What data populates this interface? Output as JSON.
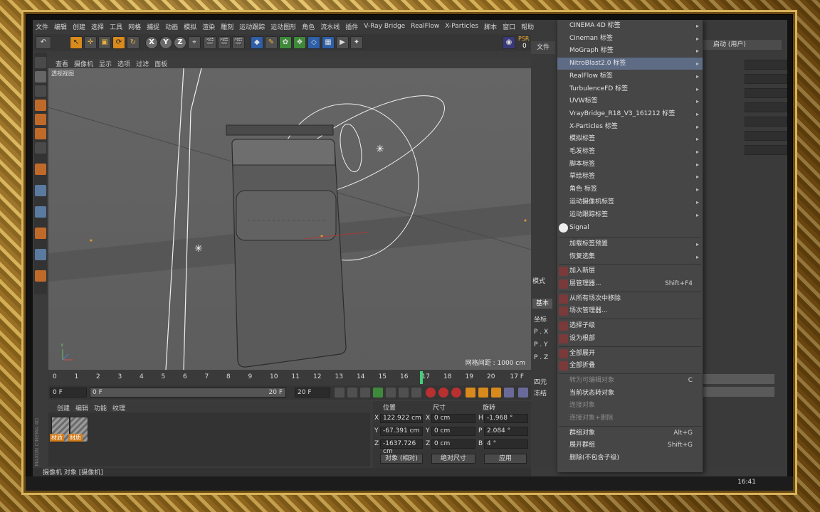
{
  "menubar": [
    "文件",
    "编辑",
    "创建",
    "选择",
    "工具",
    "网格",
    "捕捉",
    "动画",
    "模拟",
    "渲染",
    "雕刻",
    "运动跟踪",
    "运动图形",
    "角色",
    "流水线",
    "插件",
    "V-Ray Bridge",
    "RealFlow",
    "X-Particles",
    "脚本",
    "窗口",
    "帮助"
  ],
  "toolbar": {
    "undo_icon": "undo-icon",
    "x": "X",
    "y": "Y",
    "z": "Z",
    "psr_label": "PSR",
    "psr_value": "0"
  },
  "viewport": {
    "menu": [
      "查看",
      "摄像机",
      "显示",
      "选项",
      "过滤",
      "面板"
    ],
    "label": "透视视图",
    "grid_spacing": "网格间距 : 1000 cm"
  },
  "timeline": {
    "ticks": [
      "0",
      "1",
      "2",
      "3",
      "4",
      "5",
      "6",
      "7",
      "8",
      "9",
      "10",
      "11",
      "12",
      "13",
      "14",
      "15",
      "16",
      "17",
      "18",
      "19",
      "20"
    ],
    "current_frame": 17,
    "current_frame_label": "17 F"
  },
  "playback": {
    "start": "0 F",
    "slider_start": "0 F",
    "slider_end": "20 F",
    "end": "20 F"
  },
  "materials": {
    "menu": [
      "创建",
      "编辑",
      "功能",
      "纹理"
    ],
    "items": [
      {
        "label": "材质"
      },
      {
        "label": "材质"
      }
    ],
    "brand": "MAXON CINEMA 4D"
  },
  "coordinates": {
    "headers": {
      "position": "位置",
      "size": "尺寸",
      "rotation": "旋转"
    },
    "rows": [
      {
        "axis": "X",
        "position": "122.922 cm",
        "size_axis": "X",
        "size": "0 cm",
        "rot_axis": "H",
        "rotation": "-1.968 °"
      },
      {
        "axis": "Y",
        "position": "-67.391 cm",
        "size_axis": "Y",
        "size": "0 cm",
        "rot_axis": "P",
        "rotation": "2.084 °"
      },
      {
        "axis": "Z",
        "position": "-1637.726 cm",
        "size_axis": "Z",
        "size": "0 cm",
        "rot_axis": "B",
        "rotation": "4 °"
      }
    ],
    "mode_select": "对象 (相对)",
    "size_select": "绝对尺寸",
    "apply": "应用"
  },
  "status_bar": "摄像机 对象 [摄像机]",
  "right_panel": {
    "objects_tab": "文件",
    "layer_field": "启动 (用户)",
    "attr_mode": "模式",
    "attr_tab": "基本",
    "attr_coord": "坐标",
    "attr_rows": [
      "P . X",
      "P . Y",
      "P . Z"
    ],
    "attr_misc": [
      "四元",
      "冻结"
    ]
  },
  "context_menu": {
    "items": [
      {
        "label": "CINEMA 4D 标签",
        "arrow": true
      },
      {
        "label": "Cineman 标签",
        "arrow": true
      },
      {
        "label": "MoGraph 标签",
        "arrow": true
      },
      {
        "label": "NitroBlast2.0 标签",
        "arrow": true,
        "highlight": true
      },
      {
        "label": "RealFlow 标签",
        "arrow": true
      },
      {
        "label": "TurbulenceFD 标签",
        "arrow": true
      },
      {
        "label": "UVW标签",
        "arrow": true
      },
      {
        "label": "VrayBridge_R18_V3_161212 标签",
        "arrow": true
      },
      {
        "label": "X-Particles 标签",
        "arrow": true
      },
      {
        "label": "模拟标签",
        "arrow": true
      },
      {
        "label": "毛发标签",
        "arrow": true
      },
      {
        "label": "脚本标签",
        "arrow": true
      },
      {
        "label": "草绘标签",
        "arrow": true
      },
      {
        "label": "角色 标签",
        "arrow": true
      },
      {
        "label": "运动摄像机标签",
        "arrow": true
      },
      {
        "label": "运动跟踪标签",
        "arrow": true
      }
    ],
    "signal": "Signal",
    "group2": [
      {
        "label": "加载标签预置",
        "arrow": true
      },
      {
        "label": "恢复选集",
        "arrow": true
      }
    ],
    "group3": [
      {
        "label": "加入新层",
        "icon": "layer-add-icon"
      },
      {
        "label": "层管理器...",
        "shortcut": "Shift+F4",
        "icon": "layer-manager-icon"
      }
    ],
    "group4": [
      {
        "label": "从所有场次中移除",
        "icon": "take-remove-icon"
      },
      {
        "label": "场次管理器...",
        "icon": "take-manager-icon"
      }
    ],
    "group5": [
      {
        "label": "选择子级",
        "icon": "select-children-icon"
      },
      {
        "label": "设为根部",
        "icon": "set-root-icon"
      }
    ],
    "group6": [
      {
        "label": "全部展开",
        "icon": "expand-all-icon"
      },
      {
        "label": "全部折叠",
        "icon": "collapse-all-icon"
      }
    ],
    "group7": [
      {
        "label": "转为可编辑对象",
        "shortcut": "C",
        "disabled": true
      },
      {
        "label": "当前状态转对象",
        "disabled": false
      },
      {
        "label": "连接对象",
        "disabled": true
      },
      {
        "label": "连接对象+删除",
        "disabled": true
      }
    ],
    "group8": [
      {
        "label": "群组对象",
        "shortcut": "Alt+G"
      },
      {
        "label": "展开群组",
        "shortcut": "Shift+G"
      },
      {
        "label": "删除(不包含子级)"
      }
    ]
  },
  "taskbar": {
    "clock": "16:41"
  },
  "colors": {
    "accent": "#d98a1c",
    "highlight": "#5d6b85",
    "timeline_marker": "#3fd07a"
  }
}
